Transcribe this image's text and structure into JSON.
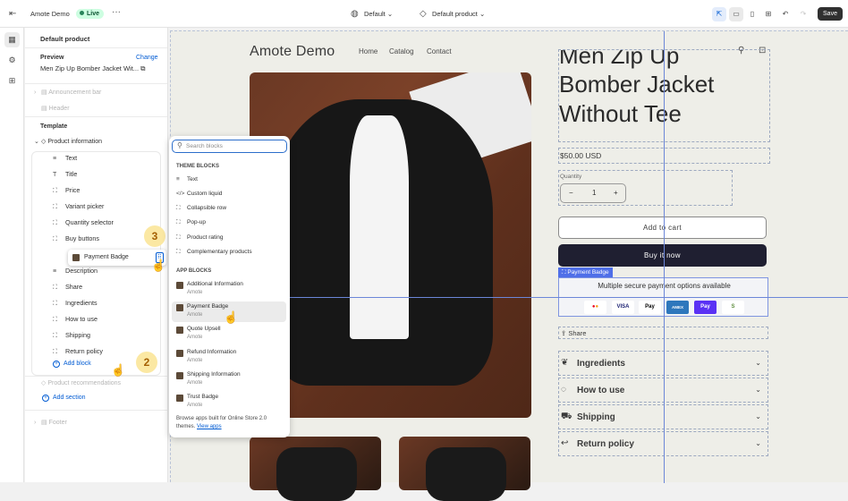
{
  "topbar": {
    "exit_icon": "exit-icon",
    "store_name": "Amote Demo",
    "status": "Live",
    "more": "···",
    "theme_select": "Default",
    "template_select": "Default product",
    "save_label": "Save"
  },
  "panel": {
    "title": "Default product",
    "preview_label": "Preview",
    "change_label": "Change",
    "preview_product": "Men Zip Up Bomber Jacket Wit...",
    "announcement": "Announcement bar",
    "header": "Header",
    "template_label": "Template",
    "product_information": "Product information",
    "blocks": [
      {
        "icon": "≡",
        "label": "Text"
      },
      {
        "icon": "T",
        "label": "Title"
      },
      {
        "icon": "⛶",
        "label": "Price"
      },
      {
        "icon": "⛶",
        "label": "Variant picker"
      },
      {
        "icon": "⛶",
        "label": "Quantity selector"
      },
      {
        "icon": "⛶",
        "label": "Buy buttons"
      },
      {
        "icon": "≡",
        "label": "Description"
      },
      {
        "icon": "⛶",
        "label": "Share"
      },
      {
        "icon": "⛶",
        "label": "Ingredients"
      },
      {
        "icon": "⛶",
        "label": "How to use"
      },
      {
        "icon": "⛶",
        "label": "Shipping"
      },
      {
        "icon": "⛶",
        "label": "Return policy"
      }
    ],
    "dragging_block": "Payment Badge",
    "add_block": "Add block",
    "product_recommendations": "Product recommendations",
    "add_section": "Add section",
    "footer": "Footer",
    "step_3": "3",
    "step_2": "2"
  },
  "popup": {
    "search_placeholder": "Search blocks",
    "theme_blocks_heading": "THEME BLOCKS",
    "theme_blocks": [
      {
        "icon": "≡",
        "label": "Text"
      },
      {
        "icon": "</>",
        "label": "Custom liquid"
      },
      {
        "icon": "⛶",
        "label": "Collapsible row"
      },
      {
        "icon": "⛶",
        "label": "Pop-up"
      },
      {
        "icon": "⛶",
        "label": "Product rating"
      },
      {
        "icon": "⛶",
        "label": "Complementary products"
      }
    ],
    "app_blocks_heading": "APP BLOCKS",
    "app_blocks": [
      {
        "name": "Additional Information",
        "vendor": "Amote"
      },
      {
        "name": "Payment Badge",
        "vendor": "Amote"
      },
      {
        "name": "Quote Upsell",
        "vendor": "Amote"
      },
      {
        "name": "Refund Information",
        "vendor": "Amote"
      },
      {
        "name": "Shipping Information",
        "vendor": "Amote"
      },
      {
        "name": "Trust Badge",
        "vendor": "Amote"
      }
    ],
    "note": "Browse apps built for Online Store 2.0 themes.",
    "note_link": "View apps"
  },
  "store": {
    "logo": "Amote Demo",
    "nav": [
      "Home",
      "Catalog",
      "Contact"
    ],
    "title_line1": "Men Zip Up",
    "title_line2": "Bomber Jacket",
    "title_line3": "Without Tee",
    "price": "$50.00 USD",
    "quantity_label": "Quantity",
    "quantity_minus": "−",
    "quantity_value": "1",
    "quantity_plus": "+",
    "add_to_cart": "Add to cart",
    "buy_now": "Buy it now",
    "payment_badge_tag": "Payment Badge",
    "payment_text": "Multiple secure payment options available",
    "payment_methods": [
      "VISA",
      "Pay",
      "AMEX",
      "Pay",
      "S"
    ],
    "share": "Share",
    "accordions": [
      "Ingredients",
      "How to use",
      "Shipping",
      "Return policy"
    ]
  },
  "colors": {
    "accent_blue": "#005bd3",
    "live_green": "#29845a",
    "buy_button": "#1f1f31",
    "selection_outline": "#6b86d8"
  }
}
